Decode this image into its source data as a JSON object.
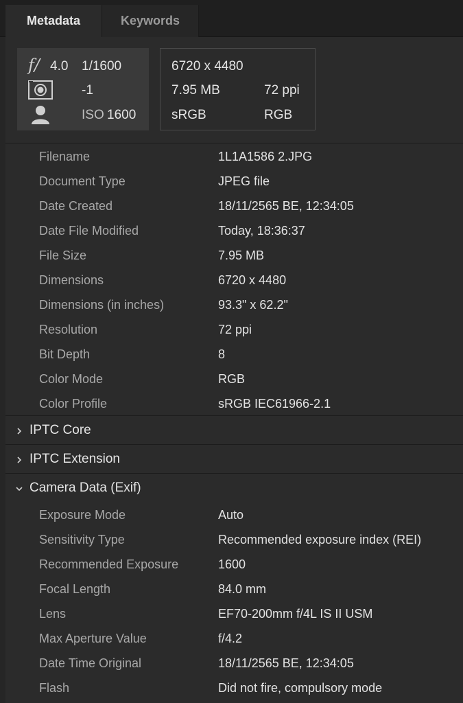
{
  "tabs": [
    {
      "label": "Metadata"
    },
    {
      "label": "Keywords"
    }
  ],
  "camera_summary": {
    "aperture": "4.0",
    "shutter": "1/1600",
    "exposure_comp": "-1",
    "iso_label": "ISO",
    "iso": "1600"
  },
  "file_summary": {
    "dimensions": "6720 x 4480",
    "size": "7.95 MB",
    "resolution": "72 ppi",
    "color_profile": "sRGB",
    "color_mode": "RGB"
  },
  "file_properties": [
    {
      "label": "Filename",
      "value": "1L1A1586 2.JPG"
    },
    {
      "label": "Document Type",
      "value": "JPEG file"
    },
    {
      "label": "Date Created",
      "value": "18/11/2565 BE, 12:34:05"
    },
    {
      "label": "Date File Modified",
      "value": "Today, 18:36:37"
    },
    {
      "label": "File Size",
      "value": "7.95 MB"
    },
    {
      "label": "Dimensions",
      "value": "6720 x 4480"
    },
    {
      "label": "Dimensions (in inches)",
      "value": "93.3\" x 62.2\""
    },
    {
      "label": "Resolution",
      "value": "72 ppi"
    },
    {
      "label": "Bit Depth",
      "value": "8"
    },
    {
      "label": "Color Mode",
      "value": "RGB"
    },
    {
      "label": "Color Profile",
      "value": "sRGB IEC61966-2.1"
    }
  ],
  "sections": {
    "iptc_core": {
      "title": "IPTC Core",
      "expanded": false
    },
    "iptc_extension": {
      "title": "IPTC Extension",
      "expanded": false
    },
    "camera_data": {
      "title": "Camera Data (Exif)",
      "expanded": true
    }
  },
  "camera_properties": [
    {
      "label": "Exposure Mode",
      "value": "Auto"
    },
    {
      "label": "Sensitivity Type",
      "value": "Recommended exposure index (REI)"
    },
    {
      "label": "Recommended Exposure",
      "value": "1600"
    },
    {
      "label": "Focal Length",
      "value": "84.0 mm"
    },
    {
      "label": "Lens",
      "value": "EF70-200mm f/4L IS II USM"
    },
    {
      "label": "Max Aperture Value",
      "value": "f/4.2"
    },
    {
      "label": "Date Time Original",
      "value": "18/11/2565 BE, 12:34:05"
    },
    {
      "label": "Flash",
      "value": "Did not fire, compulsory mode"
    }
  ],
  "icons": [
    "aperture-f-icon",
    "metering-icon",
    "person-icon",
    "chevron-right-icon",
    "chevron-down-icon"
  ]
}
